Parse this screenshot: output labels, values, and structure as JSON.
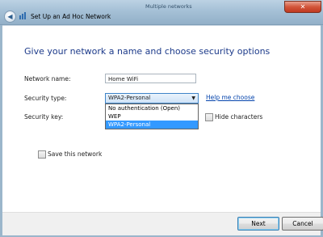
{
  "window": {
    "title": "Set Up an Ad Hoc Network",
    "background_title": "Multiple networks",
    "close_glyph": "✕"
  },
  "form": {
    "heading": "Give your network a name and choose security options",
    "network_name_label": "Network name:",
    "network_name_value": "Home WiFi",
    "security_type_label": "Security type:",
    "security_type_selected": "WPA2-Personal",
    "security_type_options": [
      "No authentication (Open)",
      "WEP",
      "WPA2-Personal"
    ],
    "help_link": "Help me choose",
    "security_key_label": "Security key:",
    "hide_characters_label": "Hide characters",
    "save_network_label": "Save this network"
  },
  "footer": {
    "next_label": "Next",
    "cancel_label": "Cancel"
  },
  "colors": {
    "heading": "#1c3a8a",
    "link": "#0645ad",
    "selection": "#3399ff"
  },
  "icons": {
    "back": "back-arrow-icon",
    "network": "network-icon",
    "dropdown": "chevron-down-icon"
  }
}
